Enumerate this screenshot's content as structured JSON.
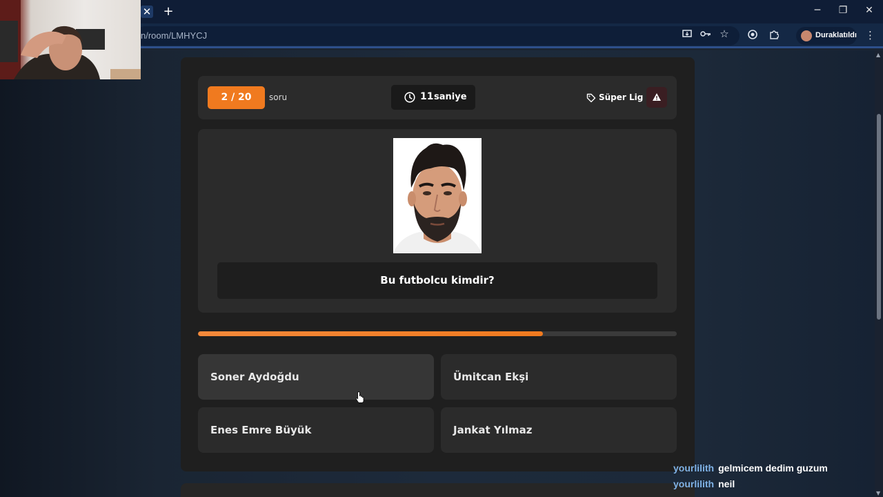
{
  "browser": {
    "url": "n/room/LMHYCJ",
    "profile_label": "Duraklatıldı",
    "icons": [
      "close-icon",
      "plus-icon",
      "minimize-icon",
      "restore-icon",
      "window-close-icon",
      "install-icon",
      "key-icon",
      "star-icon",
      "extension-icon",
      "puzzle-icon",
      "more-icon"
    ]
  },
  "quiz": {
    "counter": "2 / 20",
    "counter_label": "soru",
    "timer_value": "11",
    "timer_unit": "saniye",
    "league": "Süper Lig",
    "question": "Bu futbolcu kimdir?",
    "progress": 0.72,
    "answers": [
      {
        "label": "Soner Aydoğdu"
      },
      {
        "label": "Ümitcan Ekşi"
      },
      {
        "label": "Enes Emre Büyük"
      },
      {
        "label": "Jankat Yılmaz"
      }
    ],
    "accent_color": "#f07a1f"
  },
  "chat": [
    {
      "user": "yourlilith",
      "message": "gelmicem dedim guzum"
    },
    {
      "user": "yourlilith",
      "message": "neil"
    }
  ]
}
